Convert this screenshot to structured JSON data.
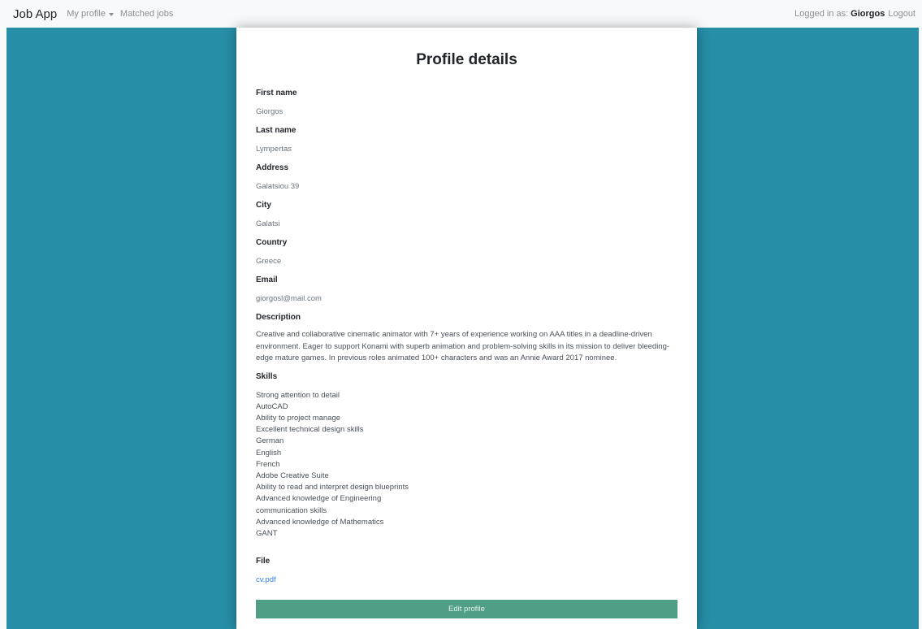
{
  "navbar": {
    "brand": "Job App",
    "my_profile": "My profile",
    "matched_jobs": "Matched jobs",
    "logged_in_prefix": "Logged in as:",
    "username": "Giorgos",
    "logout": "Logout"
  },
  "profile": {
    "title": "Profile details",
    "fields": [
      {
        "label": "First name",
        "value": "Giorgos"
      },
      {
        "label": "Last name",
        "value": "Lympertas"
      },
      {
        "label": "Address",
        "value": "Galatsiou 39"
      },
      {
        "label": "City",
        "value": "Galatsi"
      },
      {
        "label": "Country",
        "value": "Greece"
      },
      {
        "label": "Email",
        "value": "giorgosl@mail.com"
      }
    ],
    "description_label": "Description",
    "description": "Creative and collaborative cinematic animator with 7+ years of experience working on AAA titles in a deadline-driven environment. Eager to support Konami with superb animation and problem-solving skills in its mission to deliver bleeding-edge mature games. In previous roles animated 100+ characters and was an Annie Award 2017 nominee.",
    "skills_label": "Skills",
    "skills": [
      "Strong attention to detail",
      "AutoCAD",
      "Ability to project manage",
      "Excellent technical design skills",
      "German",
      "English",
      "French",
      "Adobe Creative Suite",
      "Ability to read and interpret design blueprints",
      "Advanced knowledge of Engineering",
      "communication skills",
      "Advanced knowledge of Mathematics",
      "GANT"
    ],
    "file_label": "File",
    "file_name": "cv.pdf",
    "edit_button": "Edit profile"
  },
  "colors": {
    "background_teal": "#268ea6",
    "button_green": "#4f9e85",
    "link_blue": "#2f80ed"
  }
}
